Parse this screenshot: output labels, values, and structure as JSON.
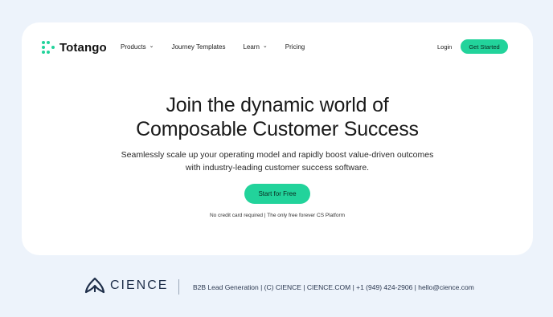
{
  "header": {
    "brand": "Totango",
    "nav": [
      {
        "label": "Products",
        "has_dropdown": true
      },
      {
        "label": "Journey Templates",
        "has_dropdown": false
      },
      {
        "label": "Learn",
        "has_dropdown": true
      },
      {
        "label": "Pricing",
        "has_dropdown": false
      }
    ],
    "login_label": "Login",
    "get_started_label": "Get Started"
  },
  "hero": {
    "headline_line1": "Join the dynamic world of",
    "headline_line2": "Composable Customer Success",
    "subtext_line1": "Seamlessly scale up your operating model and rapidly boost value-driven outcomes",
    "subtext_line2": "with industry-leading customer success software.",
    "cta_label": "Start for Free",
    "note": "No credit card required | The only free forever CS Platform"
  },
  "footer": {
    "brand": "CIENCE",
    "info": "B2B Lead Generation | (C) CIENCE | CIENCE.COM | +1 (949) 424-2906 | hello@cience.com"
  },
  "colors": {
    "accent": "#22d39b",
    "background": "#edf3fb",
    "card": "#ffffff",
    "footer_text": "#2b3850"
  },
  "icons": {
    "brand_logo": "totango-dots-logo-icon",
    "dropdown": "chevron-down-icon",
    "footer_logo": "cience-logo-icon"
  }
}
